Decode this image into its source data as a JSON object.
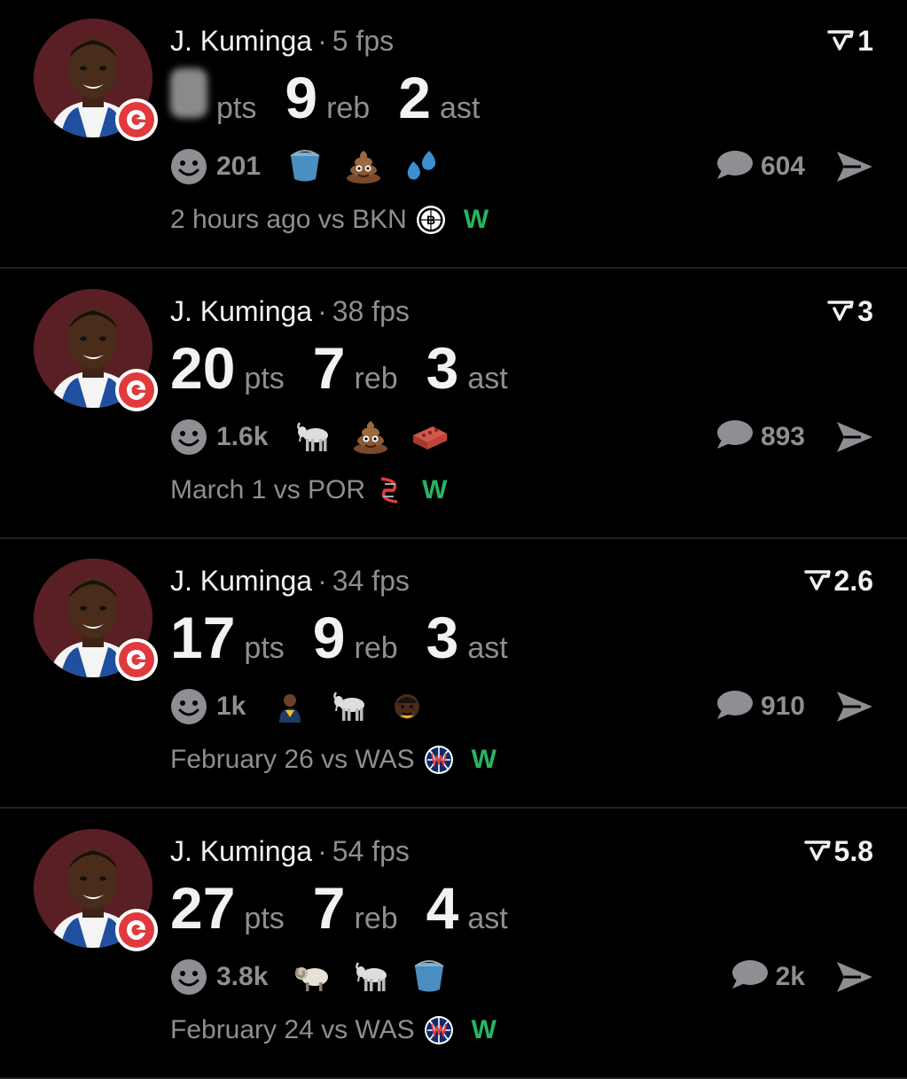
{
  "feed": [
    {
      "player": "J. Kuminga",
      "separator": "·",
      "fps": "5 fps",
      "score": "1",
      "stats": [
        {
          "value": "",
          "unit": "pts",
          "hidden": true
        },
        {
          "value": "9",
          "unit": "reb"
        },
        {
          "value": "2",
          "unit": "ast"
        }
      ],
      "reaction_count": "201",
      "reaction_icons": [
        "bucket-icon",
        "poop-icon",
        "sweat-drops-icon"
      ],
      "comment_count": "604",
      "time": "2 hours ago",
      "vs": "vs BKN",
      "opponent_logo": "nets-logo",
      "result": "W"
    },
    {
      "player": "J. Kuminga",
      "separator": "·",
      "fps": "38 fps",
      "score": "3",
      "stats": [
        {
          "value": "20",
          "unit": "pts"
        },
        {
          "value": "7",
          "unit": "reb"
        },
        {
          "value": "3",
          "unit": "ast"
        }
      ],
      "reaction_count": "1.6k",
      "reaction_icons": [
        "goat-icon",
        "poop-icon",
        "brick-icon"
      ],
      "comment_count": "893",
      "time": "March 1",
      "vs": "vs POR",
      "opponent_logo": "blazers-logo",
      "result": "W"
    },
    {
      "player": "J. Kuminga",
      "separator": "·",
      "fps": "34 fps",
      "score": "2.6",
      "stats": [
        {
          "value": "17",
          "unit": "pts"
        },
        {
          "value": "9",
          "unit": "reb"
        },
        {
          "value": "3",
          "unit": "ast"
        }
      ],
      "reaction_count": "1k",
      "reaction_icons": [
        "player-avatar-icon",
        "goat-icon",
        "player-face-icon"
      ],
      "comment_count": "910",
      "time": "February 26",
      "vs": "vs WAS",
      "opponent_logo": "wizards-logo",
      "result": "W"
    },
    {
      "player": "J. Kuminga",
      "separator": "·",
      "fps": "54 fps",
      "score": "5.8",
      "stats": [
        {
          "value": "27",
          "unit": "pts"
        },
        {
          "value": "7",
          "unit": "reb"
        },
        {
          "value": "4",
          "unit": "ast"
        }
      ],
      "reaction_count": "3.8k",
      "reaction_icons": [
        "ram-icon",
        "goat-icon",
        "bucket-icon"
      ],
      "comment_count": "2k",
      "time": "February 24",
      "vs": "vs WAS",
      "opponent_logo": "wizards-logo",
      "result": "W"
    }
  ],
  "colors": {
    "background": "#000000",
    "primary_text": "#f2f2f2",
    "secondary_text": "#8e8e93",
    "win": "#28b463",
    "hawks_red": "#e03a3e"
  }
}
